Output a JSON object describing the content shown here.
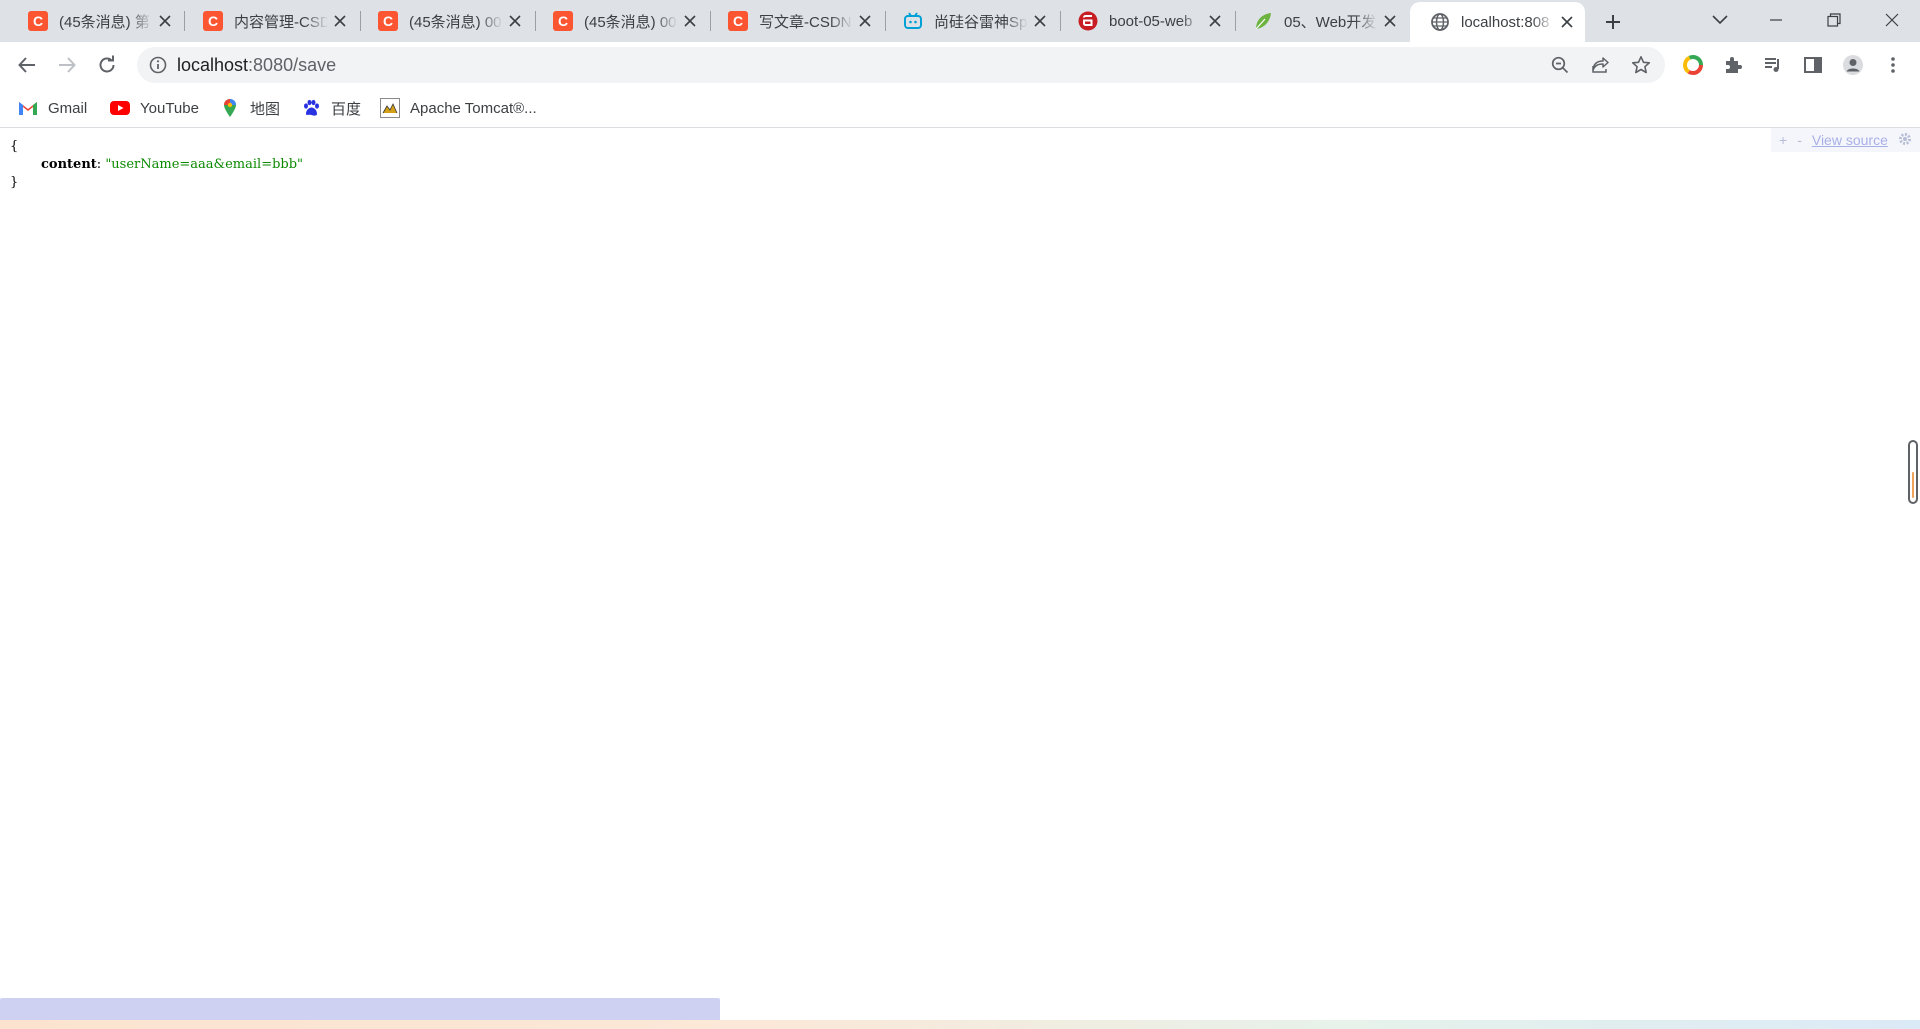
{
  "tabs": [
    {
      "title": "(45条消息) 第",
      "icon": "csdn-icon"
    },
    {
      "title": "内容管理-CSDN",
      "icon": "csdn-icon"
    },
    {
      "title": "(45条消息) 00",
      "icon": "csdn-icon"
    },
    {
      "title": "(45条消息) 00",
      "icon": "csdn-icon"
    },
    {
      "title": "写文章-CSDN",
      "icon": "csdn-icon"
    },
    {
      "title": "尚硅谷雷神Sp",
      "icon": "bilibili-icon"
    },
    {
      "title": "boot-05-web",
      "icon": "gitee-icon"
    },
    {
      "title": "05、Web开发",
      "icon": "leaf-icon"
    },
    {
      "title": "localhost:808",
      "icon": "globe-icon"
    }
  ],
  "colors": {
    "csdn": "#fc5531",
    "bilibili": "#00a1d6",
    "gitee": "#c71d23",
    "spring": "#6db33f",
    "json_string": "#0b8a00"
  },
  "omnibox": {
    "host": "localhost",
    "path": ":8080/save"
  },
  "bookmarks": [
    {
      "label": "Gmail",
      "icon": "gmail-icon"
    },
    {
      "label": "YouTube",
      "icon": "youtube-icon"
    },
    {
      "label": "地图",
      "icon": "maps-pin-icon"
    },
    {
      "label": "百度",
      "icon": "baidu-paw-icon"
    },
    {
      "label": "Apache Tomcat®...",
      "icon": "tomcat-icon"
    }
  ],
  "json_view": {
    "open_brace": "{",
    "key": "content",
    "colon": ":",
    "value": "\"userName=aaa&email=bbb\"",
    "close_brace": "}"
  },
  "viewer_toolbar": {
    "expand": "+",
    "collapse": "-",
    "view_source": "View source"
  }
}
